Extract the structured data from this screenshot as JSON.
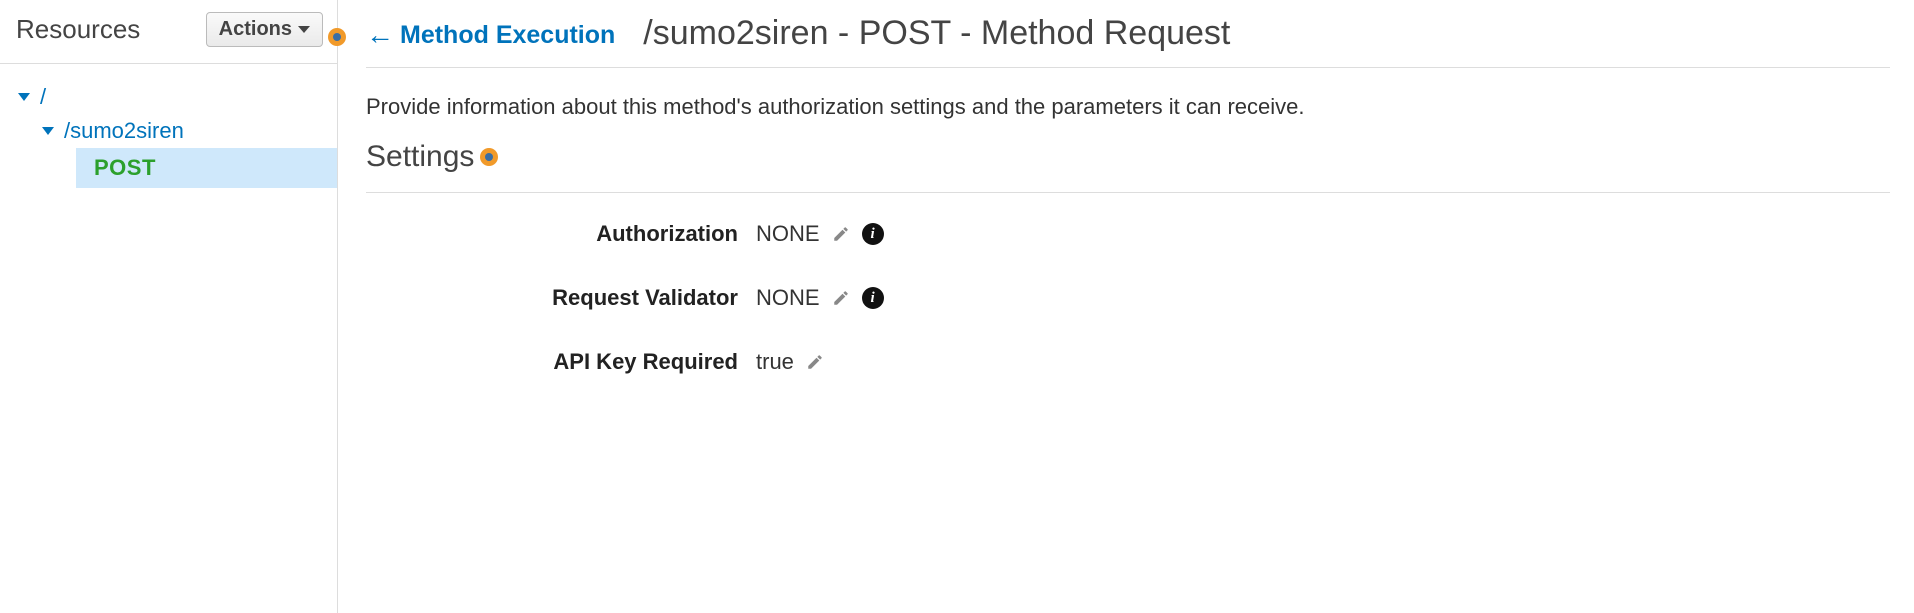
{
  "sidebar": {
    "title": "Resources",
    "actions_label": "Actions",
    "tree": {
      "root_label": "/",
      "resource_label": "/sumo2siren",
      "method_label": "POST"
    }
  },
  "main": {
    "back_link_label": "Method Execution",
    "page_title": "/sumo2siren - POST - Method Request",
    "description": "Provide information about this method's authorization settings and the parameters it can receive.",
    "section_title": "Settings",
    "settings": {
      "authorization": {
        "label": "Authorization",
        "value": "NONE",
        "editable": true,
        "has_info": true
      },
      "request_validator": {
        "label": "Request Validator",
        "value": "NONE",
        "editable": true,
        "has_info": true
      },
      "api_key_required": {
        "label": "API Key Required",
        "value": "true",
        "editable": true,
        "has_info": false
      }
    }
  }
}
